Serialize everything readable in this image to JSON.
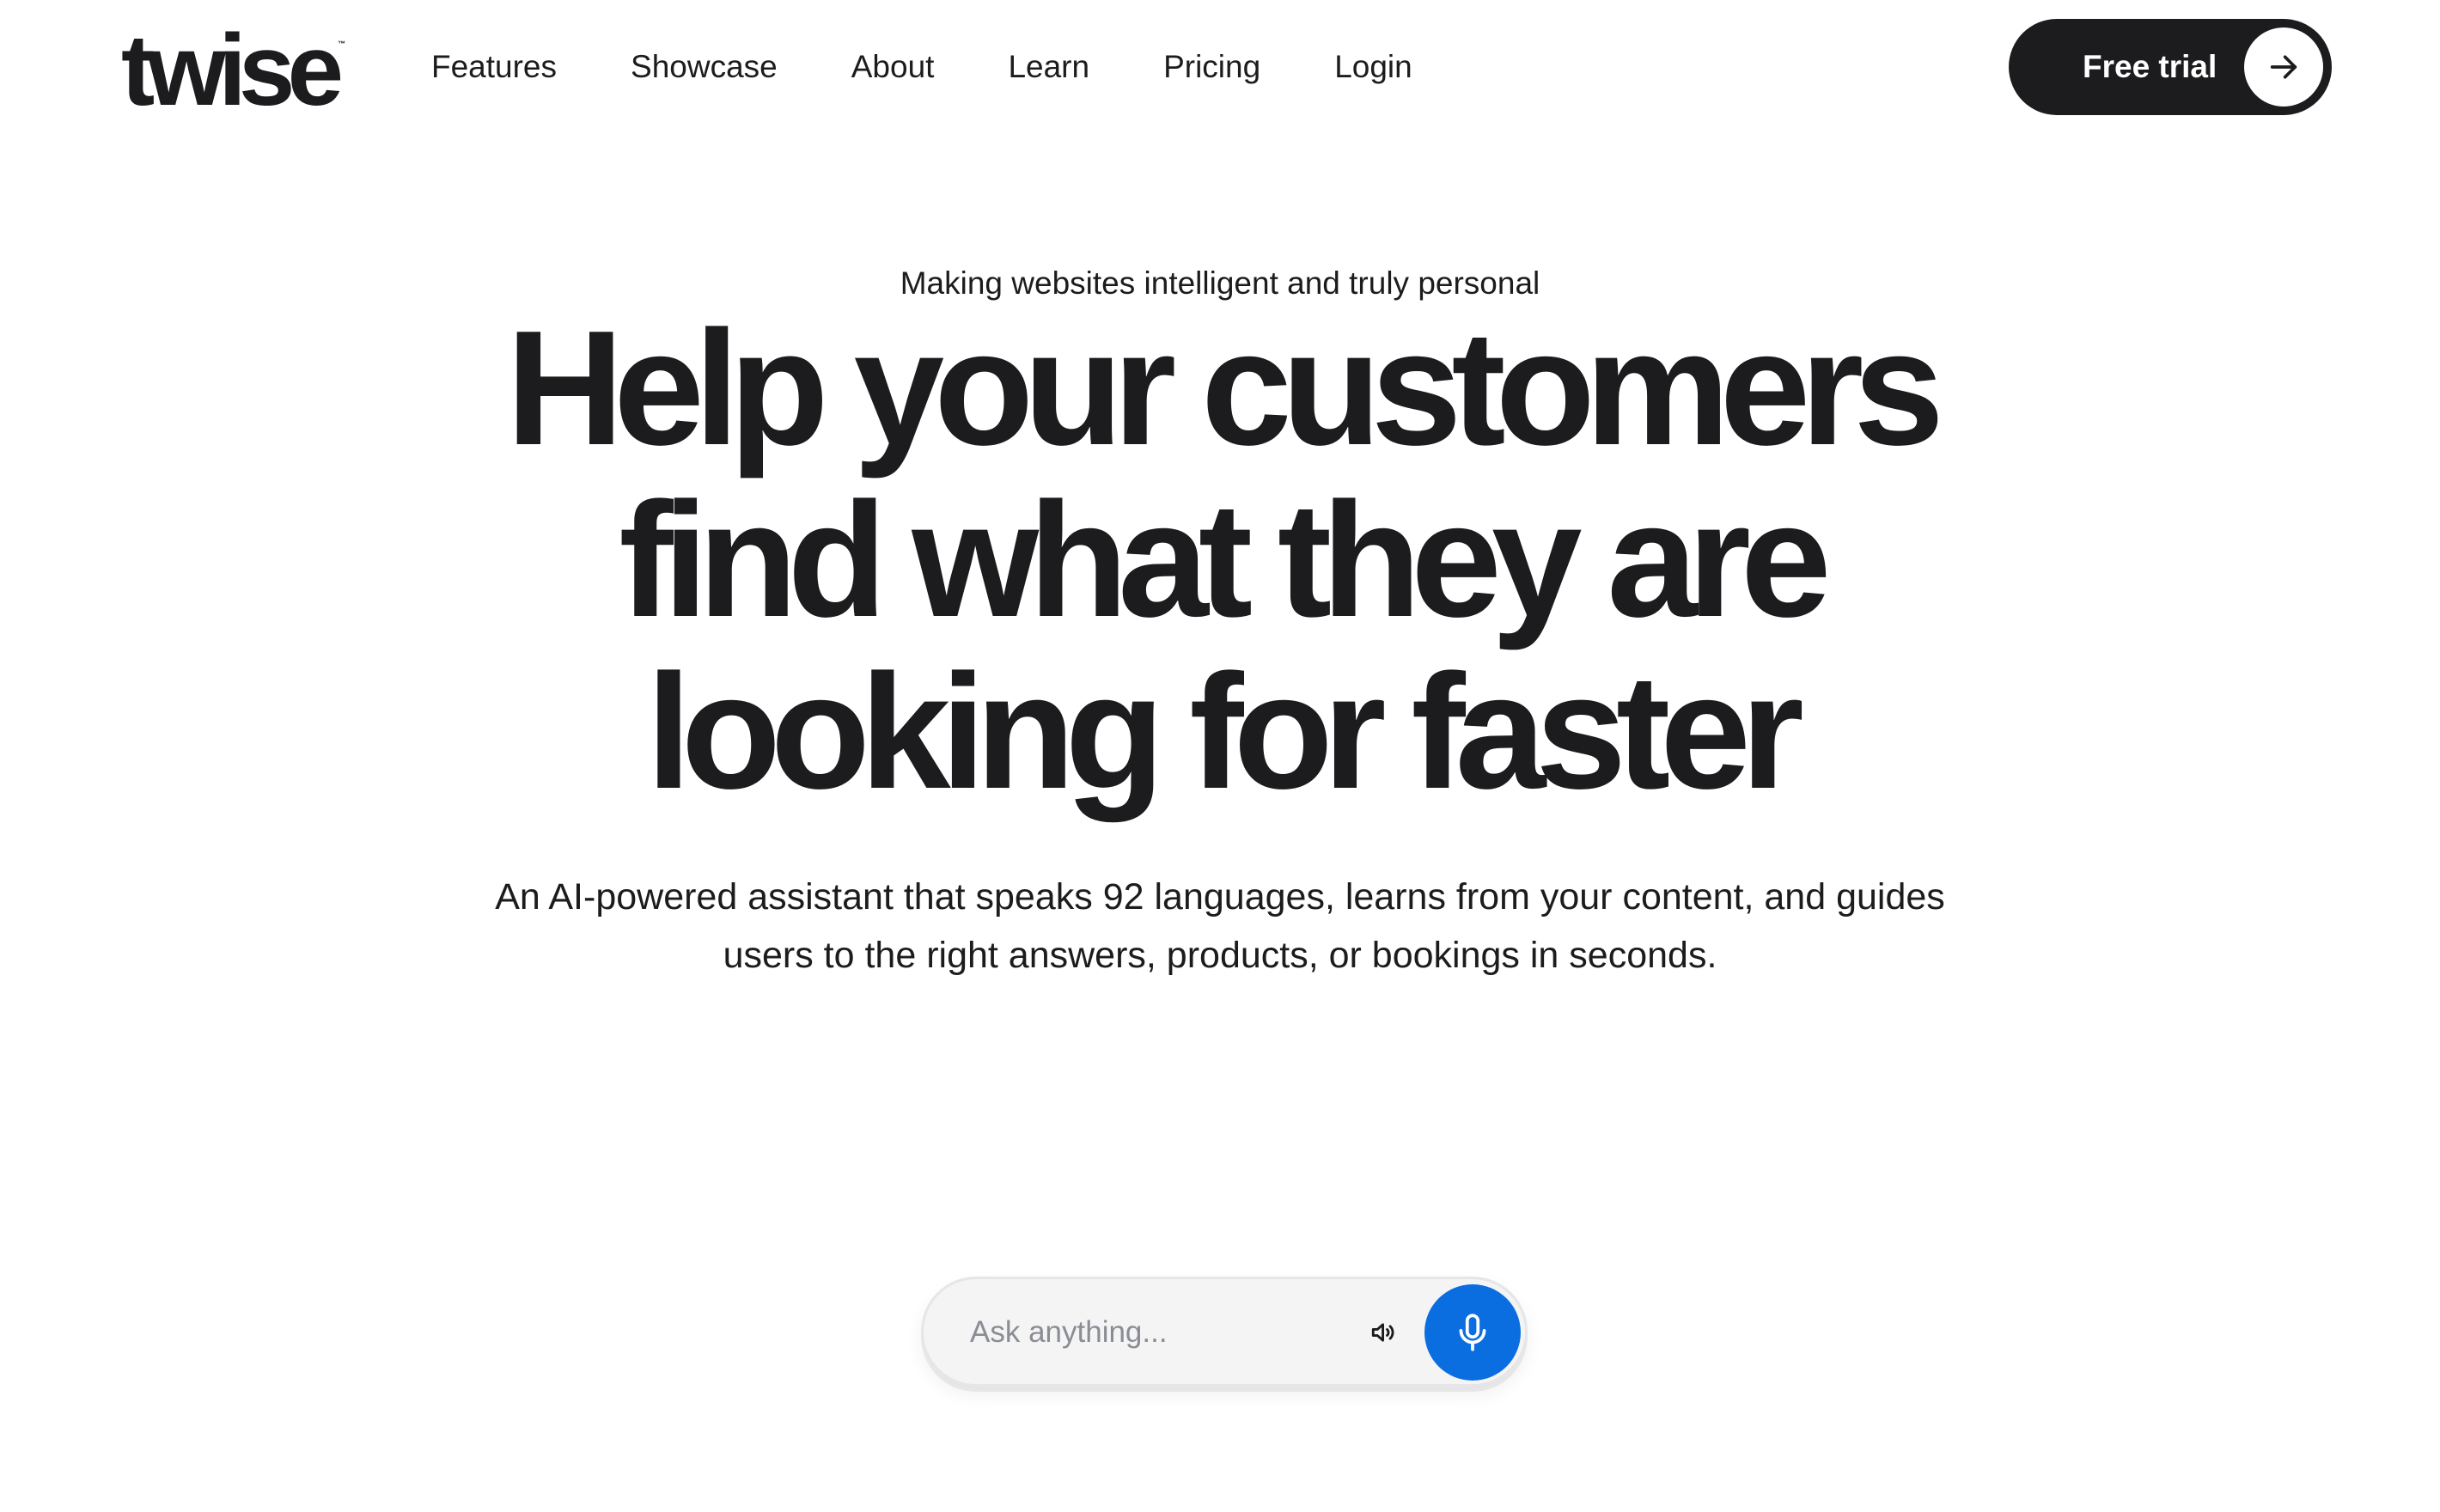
{
  "brand": {
    "logo_text": "twise",
    "logo_mark": "™"
  },
  "nav": {
    "items": [
      {
        "label": "Features"
      },
      {
        "label": "Showcase"
      },
      {
        "label": "About"
      },
      {
        "label": "Learn"
      },
      {
        "label": "Pricing"
      },
      {
        "label": "Login"
      }
    ]
  },
  "cta": {
    "label": "Free trial",
    "icon": "arrow-right-icon"
  },
  "hero": {
    "eyebrow": "Making websites intelligent and truly personal",
    "headline_lines": [
      "Help your customers",
      "find what they are",
      "looking for faster"
    ],
    "subtext_lines": [
      "An AI-powered assistant that speaks 92 languages, learns from your content, and guides",
      "users to the right answers, products, or bookings in seconds."
    ]
  },
  "ask": {
    "placeholder": "Ask anything...",
    "value": "",
    "speaker_icon": "speaker-icon",
    "mic_icon": "microphone-icon"
  },
  "colors": {
    "text": "#1c1c1e",
    "cta_background": "#1c1c1e",
    "mic_button": "#0a6ee0",
    "ask_bar_background": "#f4f4f5",
    "placeholder": "#8a8d93"
  }
}
